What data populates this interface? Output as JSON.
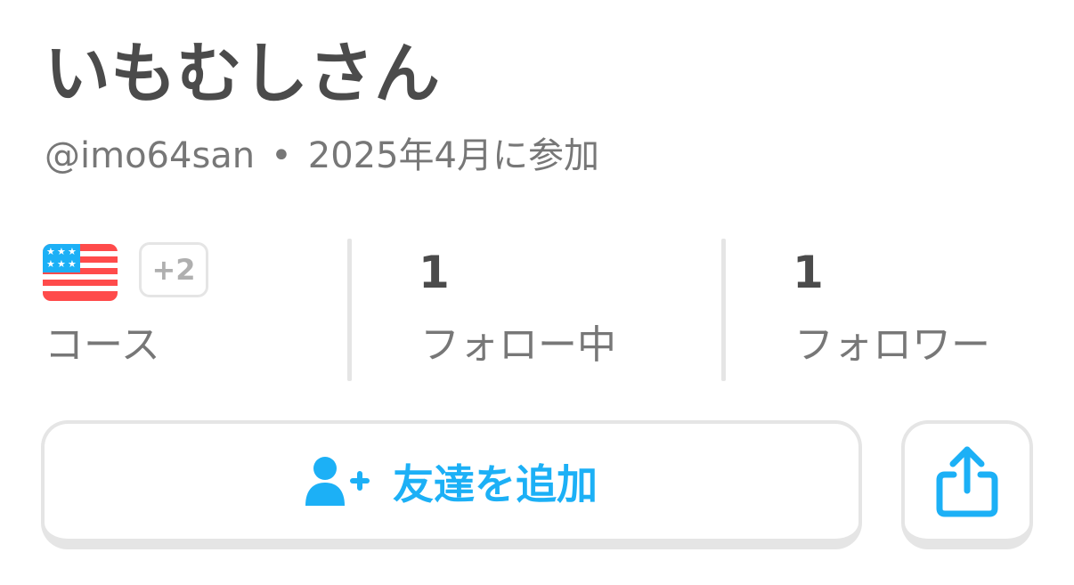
{
  "profile": {
    "display_name": "いもむしさん",
    "username": "@imo64san",
    "separator": "•",
    "joined": "2025年4月に参加"
  },
  "stats": {
    "courses": {
      "flag_icon": "us-flag-icon",
      "extra_count": "+2",
      "label": "コース"
    },
    "following": {
      "value": "1",
      "label": "フォロー中"
    },
    "followers": {
      "value": "1",
      "label": "フォロワー"
    }
  },
  "actions": {
    "add_friend": {
      "icon": "add-user-icon",
      "label": "友達を追加"
    },
    "share": {
      "icon": "share-icon"
    }
  },
  "colors": {
    "primary_text": "#4b4b4b",
    "secondary_text": "#777777",
    "accent_blue": "#1cb0f6",
    "border_gray": "#e5e5e5",
    "flag_red": "#ff4b4b",
    "flag_blue": "#1cb0f6"
  }
}
